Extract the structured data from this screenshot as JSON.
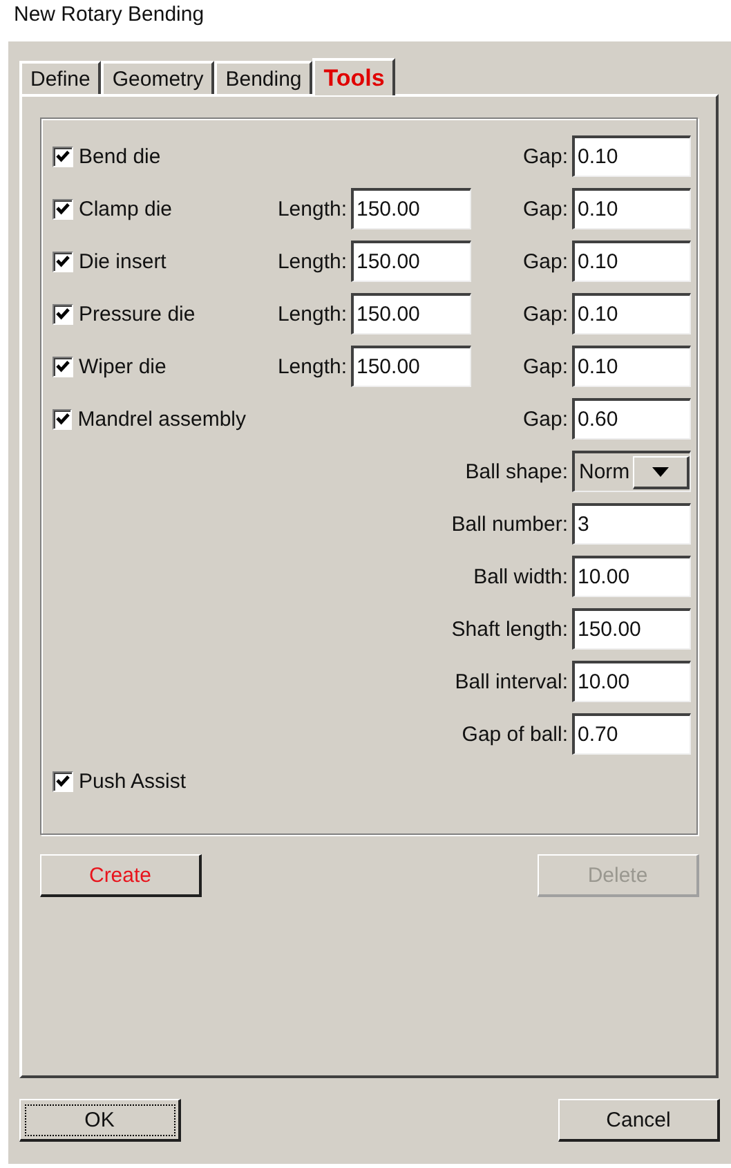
{
  "window": {
    "title": "New Rotary Bending"
  },
  "tabs": [
    {
      "label": "Define",
      "selected": false
    },
    {
      "label": "Geometry",
      "selected": false
    },
    {
      "label": "Bending",
      "selected": false
    },
    {
      "label": "Tools",
      "selected": true
    }
  ],
  "tools": [
    {
      "label": "Bend die",
      "checked": true,
      "gap_label": "Gap:",
      "gap": "0.10"
    },
    {
      "label": "Clamp die",
      "checked": true,
      "length_label": "Length:",
      "length": "150.00",
      "gap_label": "Gap:",
      "gap": "0.10"
    },
    {
      "label": "Die insert",
      "checked": true,
      "length_label": "Length:",
      "length": "150.00",
      "gap_label": "Gap:",
      "gap": "0.10"
    },
    {
      "label": "Pressure die",
      "checked": true,
      "length_label": "Length:",
      "length": "150.00",
      "gap_label": "Gap:",
      "gap": "0.10"
    },
    {
      "label": "Wiper die",
      "checked": true,
      "length_label": "Length:",
      "length": "150.00",
      "gap_label": "Gap:",
      "gap": "0.10"
    },
    {
      "label": "Mandrel assembly",
      "checked": true,
      "gap_label": "Gap:",
      "gap": "0.60"
    }
  ],
  "mandrel_params": [
    {
      "kind": "dropdown",
      "label": "Ball shape:",
      "value": "Norm"
    },
    {
      "kind": "field",
      "label": "Ball number:",
      "value": "3"
    },
    {
      "kind": "field",
      "label": "Ball width:",
      "value": "10.00"
    },
    {
      "kind": "field",
      "label": "Shaft length:",
      "value": "150.00"
    },
    {
      "kind": "field",
      "label": "Ball interval:",
      "value": "10.00"
    },
    {
      "kind": "field",
      "label": "Gap of ball:",
      "value": "0.70"
    }
  ],
  "push_assist": {
    "label": "Push Assist",
    "checked": true
  },
  "action_buttons": [
    {
      "label": "Create",
      "emphasized": true,
      "disabled": false
    },
    {
      "label": "Delete",
      "emphasized": false,
      "disabled": true
    }
  ],
  "dialog_buttons": [
    {
      "label": "OK",
      "focused": true
    },
    {
      "label": "Cancel",
      "focused": false
    }
  ]
}
